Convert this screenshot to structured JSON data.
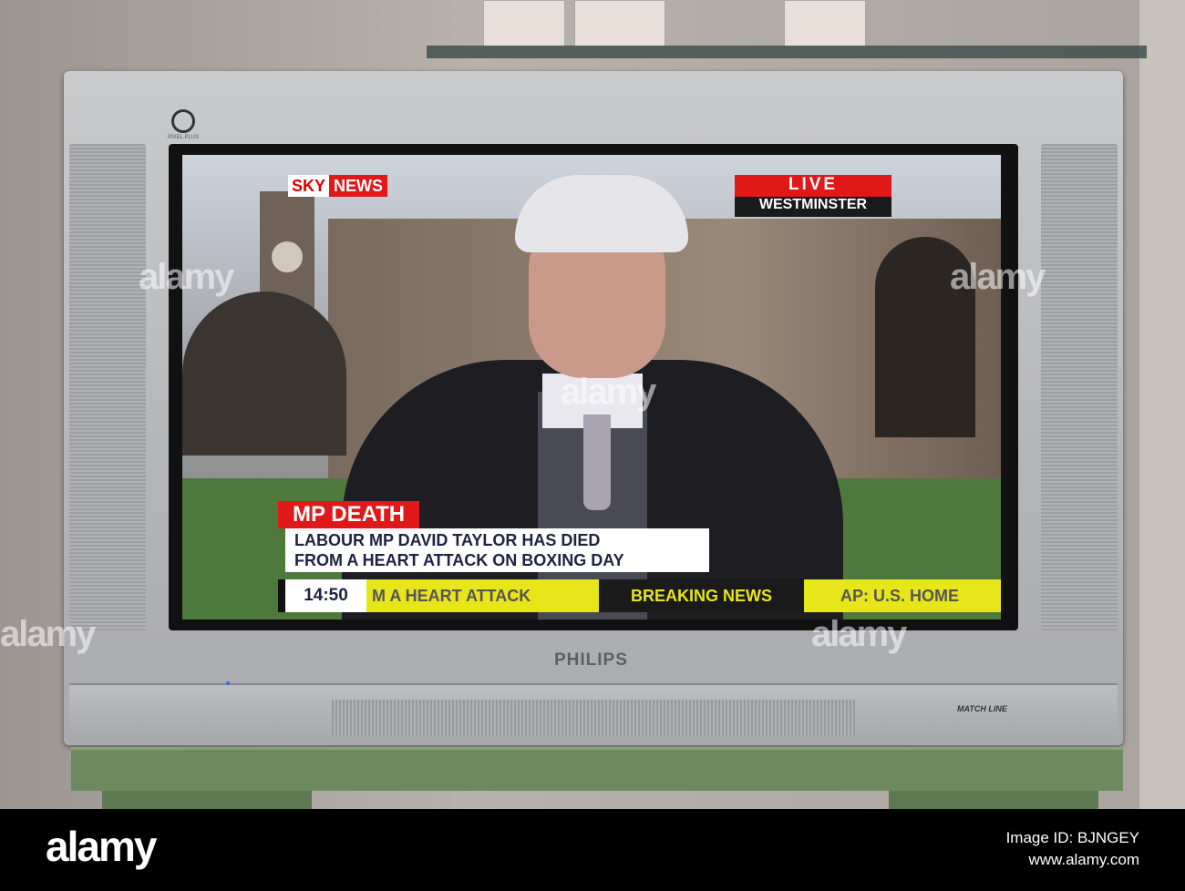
{
  "screen": {
    "channel_logo": {
      "sky": "SKY",
      "news": "NEWS"
    },
    "live_badge": {
      "label": "LIVE",
      "location": "WESTMINSTER"
    },
    "headline": "MP DEATH",
    "caption_lines": [
      "LABOUR MP DAVID TAYLOR HAS DIED",
      "FROM A HEART ATTACK ON BOXING DAY"
    ],
    "ticker": {
      "time": "14:50",
      "items": [
        "M A HEART ATTACK",
        "BREAKING NEWS",
        "AP: U.S. HOME"
      ]
    }
  },
  "tv": {
    "brand": "PHILIPS",
    "badge": "MATCH LINE",
    "pixel_plus": "PIXEL PLUS"
  },
  "watermark": "alamy",
  "footer": {
    "logo": "alamy",
    "image_id": "Image ID: BJNGEY",
    "url": "www.alamy.com"
  },
  "colors": {
    "sky_red": "#e01818",
    "ticker_yellow": "#e7e61a",
    "stand_green": "#6d8a5e"
  }
}
